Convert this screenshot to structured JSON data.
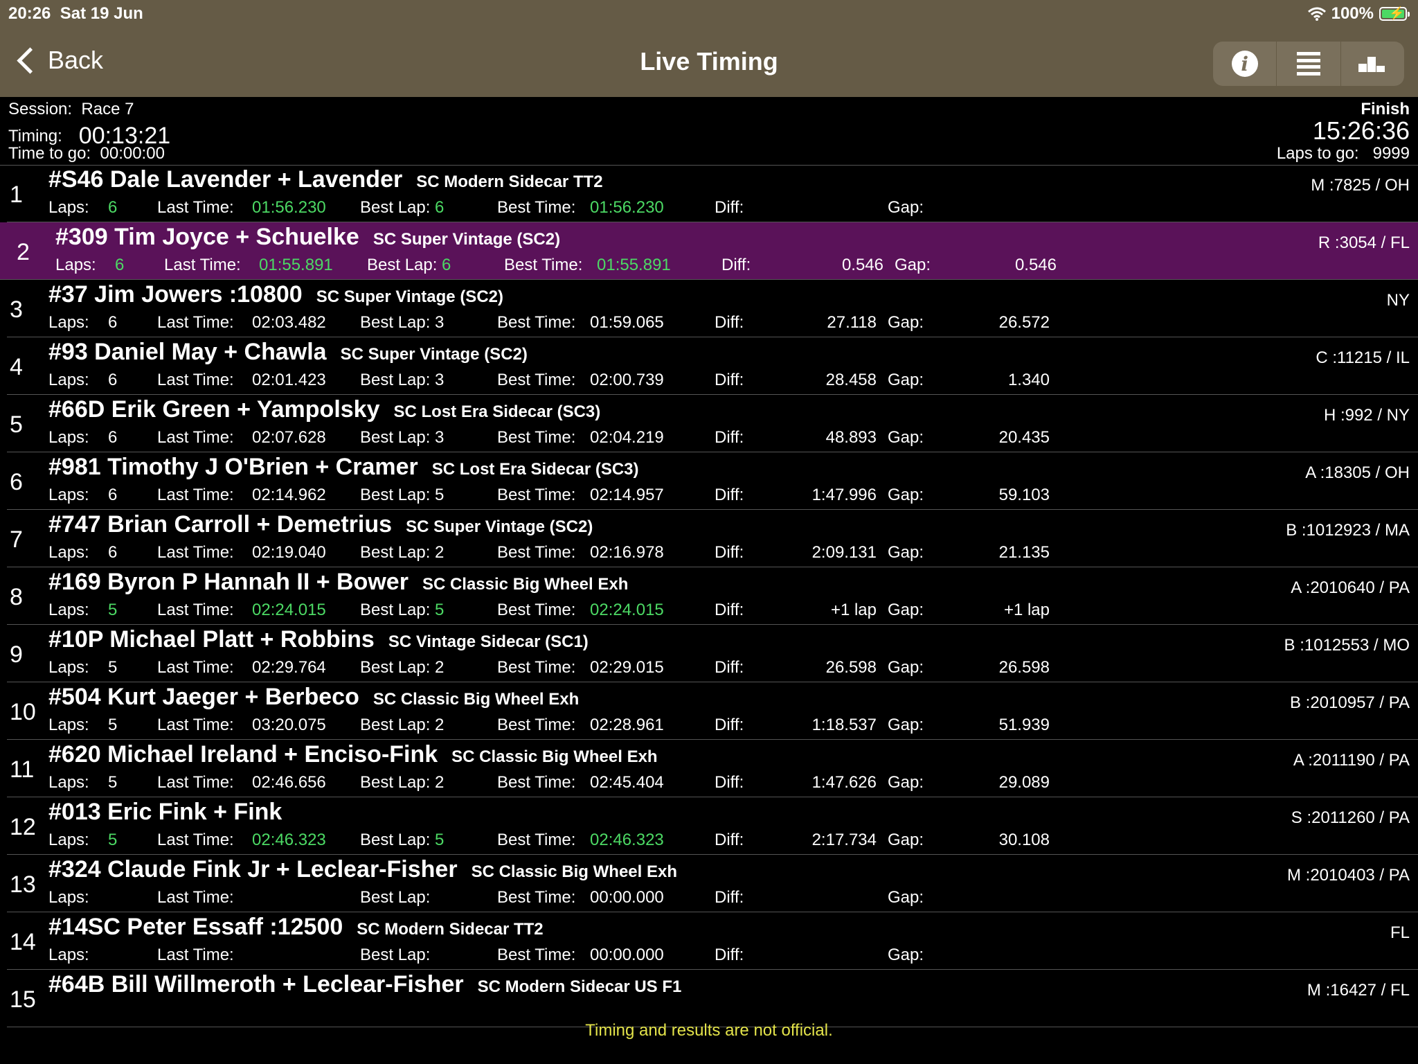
{
  "status": {
    "time": "20:26",
    "date": "Sat 19 Jun",
    "battery": "100%"
  },
  "nav": {
    "back": "Back",
    "title": "Live Timing"
  },
  "session": {
    "session_label": "Session:",
    "session_value": "Race 7",
    "timing_label": "Timing:",
    "timing_value": "00:13:21",
    "ttg_label": "Time to go:",
    "ttg_value": "00:00:00",
    "finish_label": "Finish",
    "finish_time": "15:26:36",
    "laps_to_go_label": "Laps to go:",
    "laps_to_go_value": "9999"
  },
  "labels": {
    "laps": "Laps:",
    "last": "Last Time:",
    "best_lap": "Best Lap:",
    "best_time": "Best Time:",
    "diff": "Diff:",
    "gap": "Gap:"
  },
  "rows": [
    {
      "pos": "1",
      "name": "#S46 Dale Lavender + Lavender",
      "cls": "SC Modern Sidecar TT2",
      "rc": "M :7825 / OH",
      "laps": "6",
      "last": "01:56.230",
      "bestlap": "6",
      "besttime": "01:56.230",
      "diff": "",
      "gap": "",
      "green": true
    },
    {
      "pos": "2",
      "name": "#309 Tim Joyce + Schuelke",
      "cls": "SC Super Vintage (SC2)",
      "rc": "R :3054 / FL",
      "laps": "6",
      "last": "01:55.891",
      "bestlap": "6",
      "besttime": "01:55.891",
      "diff": "0.546",
      "gap": "0.546",
      "green": true,
      "highlight": true
    },
    {
      "pos": "3",
      "name": "#37 Jim Jowers :10800",
      "cls": "SC Super Vintage (SC2)",
      "rc": "NY",
      "laps": "6",
      "last": "02:03.482",
      "bestlap": "3",
      "besttime": "01:59.065",
      "diff": "27.118",
      "gap": "26.572"
    },
    {
      "pos": "4",
      "name": "#93 Daniel May + Chawla",
      "cls": "SC Super Vintage (SC2)",
      "rc": "C :11215 / IL",
      "laps": "6",
      "last": "02:01.423",
      "bestlap": "3",
      "besttime": "02:00.739",
      "diff": "28.458",
      "gap": "1.340"
    },
    {
      "pos": "5",
      "name": "#66D Erik Green + Yampolsky",
      "cls": "SC Lost Era Sidecar (SC3)",
      "rc": "H :992 / NY",
      "laps": "6",
      "last": "02:07.628",
      "bestlap": "3",
      "besttime": "02:04.219",
      "diff": "48.893",
      "gap": "20.435"
    },
    {
      "pos": "6",
      "name": "#981 Timothy J O'Brien + Cramer",
      "cls": "SC Lost Era Sidecar (SC3)",
      "rc": "A :18305 / OH",
      "laps": "6",
      "last": "02:14.962",
      "bestlap": "5",
      "besttime": "02:14.957",
      "diff": "1:47.996",
      "gap": "59.103"
    },
    {
      "pos": "7",
      "name": "#747 Brian Carroll + Demetrius",
      "cls": "SC Super Vintage (SC2)",
      "rc": "B :1012923 / MA",
      "laps": "6",
      "last": "02:19.040",
      "bestlap": "2",
      "besttime": "02:16.978",
      "diff": "2:09.131",
      "gap": "21.135"
    },
    {
      "pos": "8",
      "name": "#169 Byron P Hannah II + Bower",
      "cls": "SC Classic Big Wheel Exh",
      "rc": "A :2010640 / PA",
      "laps": "5",
      "last": "02:24.015",
      "bestlap": "5",
      "besttime": "02:24.015",
      "diff": "+1 lap",
      "gap": "+1 lap",
      "green": true
    },
    {
      "pos": "9",
      "name": "#10P Michael Platt + Robbins",
      "cls": "SC Vintage Sidecar (SC1)",
      "rc": "B :1012553 / MO",
      "laps": "5",
      "last": "02:29.764",
      "bestlap": "2",
      "besttime": "02:29.015",
      "diff": "26.598",
      "gap": "26.598"
    },
    {
      "pos": "10",
      "name": "#504 Kurt Jaeger + Berbeco",
      "cls": "SC Classic Big Wheel Exh",
      "rc": "B :2010957 / PA",
      "laps": "5",
      "last": "03:20.075",
      "bestlap": "2",
      "besttime": "02:28.961",
      "diff": "1:18.537",
      "gap": "51.939"
    },
    {
      "pos": "11",
      "name": "#620 Michael Ireland + Enciso-Fink",
      "cls": "SC Classic Big Wheel Exh",
      "rc": "A :2011190 / PA",
      "laps": "5",
      "last": "02:46.656",
      "bestlap": "2",
      "besttime": "02:45.404",
      "diff": "1:47.626",
      "gap": "29.089"
    },
    {
      "pos": "12",
      "name": "#013 Eric Fink + Fink",
      "cls": "",
      "rc": "S :2011260 / PA",
      "laps": "5",
      "last": "02:46.323",
      "bestlap": "5",
      "besttime": "02:46.323",
      "diff": "2:17.734",
      "gap": "30.108",
      "green": true
    },
    {
      "pos": "13",
      "name": "#324 Claude Fink Jr + Leclear-Fisher",
      "cls": "SC Classic Big Wheel Exh",
      "rc": "M :2010403 / PA",
      "laps": "",
      "last": "",
      "bestlap": "",
      "besttime": "00:00.000",
      "diff": "",
      "gap": ""
    },
    {
      "pos": "14",
      "name": "#14SC Peter Essaff :12500",
      "cls": "SC Modern Sidecar TT2",
      "rc": "FL",
      "laps": "",
      "last": "",
      "bestlap": "",
      "besttime": "00:00.000",
      "diff": "",
      "gap": ""
    },
    {
      "pos": "15",
      "name": "#64B Bill Willmeroth + Leclear-Fisher",
      "cls": "SC Modern Sidecar US F1",
      "rc": "M :16427 / FL",
      "laps": "",
      "last": "",
      "bestlap": "",
      "besttime": "",
      "diff": "",
      "gap": "",
      "nostats": true
    }
  ],
  "footer": "Timing and results are not official.",
  "colors": {
    "nav_bg": "#655b46",
    "highlight": "#5a1259",
    "green": "#4cd964",
    "footer": "#e3e34a"
  }
}
